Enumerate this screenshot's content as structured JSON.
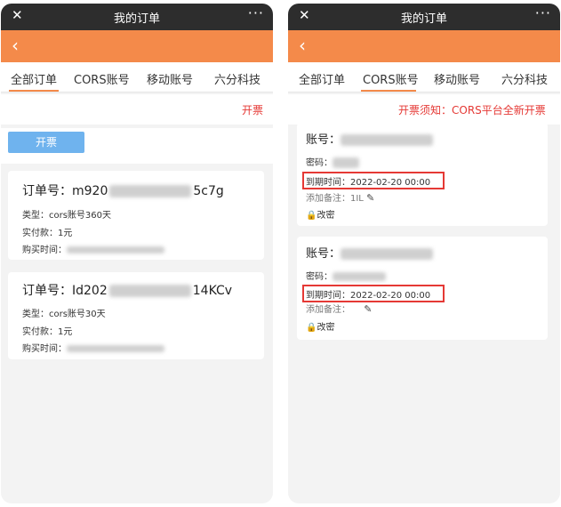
{
  "topbar": {
    "title": "我的订单",
    "close_icon": "✕",
    "more_icon": "···"
  },
  "navbar": {
    "back_icon": "‹"
  },
  "tabs": [
    {
      "label": "全部订单"
    },
    {
      "label": "CORS账号"
    },
    {
      "label": "移动账号"
    },
    {
      "label": "六分科技"
    }
  ],
  "left": {
    "notice": "开票",
    "invoice_button": "开票",
    "orders": [
      {
        "order_prefix": "订单号：m920",
        "order_suffix": "5c7g",
        "type": "类型：cors账号360天",
        "paid": "实付款：1元",
        "time_label": "购买时间："
      },
      {
        "order_prefix": "订单号：Id202",
        "order_suffix": "14KCv",
        "type": "类型：cors账号30天",
        "paid": "实付款：1元",
        "time_label": "购买时间："
      }
    ]
  },
  "right": {
    "notice": "开票须知：CORS平台全新开票",
    "accounts": [
      {
        "account_label": "账号：",
        "password_label": "密码：",
        "expire": "到期时间：2022-02-20 00:00",
        "remark_label": "添加备注：",
        "remark_value": "1IL",
        "change_password": "改密"
      },
      {
        "account_label": "账号：",
        "password_label": "密码：",
        "expire": "到期时间：2022-02-20 00:00",
        "remark_label": "添加备注：",
        "remark_value": "",
        "change_password": "改密"
      }
    ]
  },
  "colors": {
    "accent": "#f48a4a",
    "topbar": "#2d2d2d",
    "notice": "#e53935",
    "button": "#6fb3ee",
    "highlight": "#e53935"
  },
  "icons": {
    "pencil": "✎",
    "lock": "🔒"
  }
}
